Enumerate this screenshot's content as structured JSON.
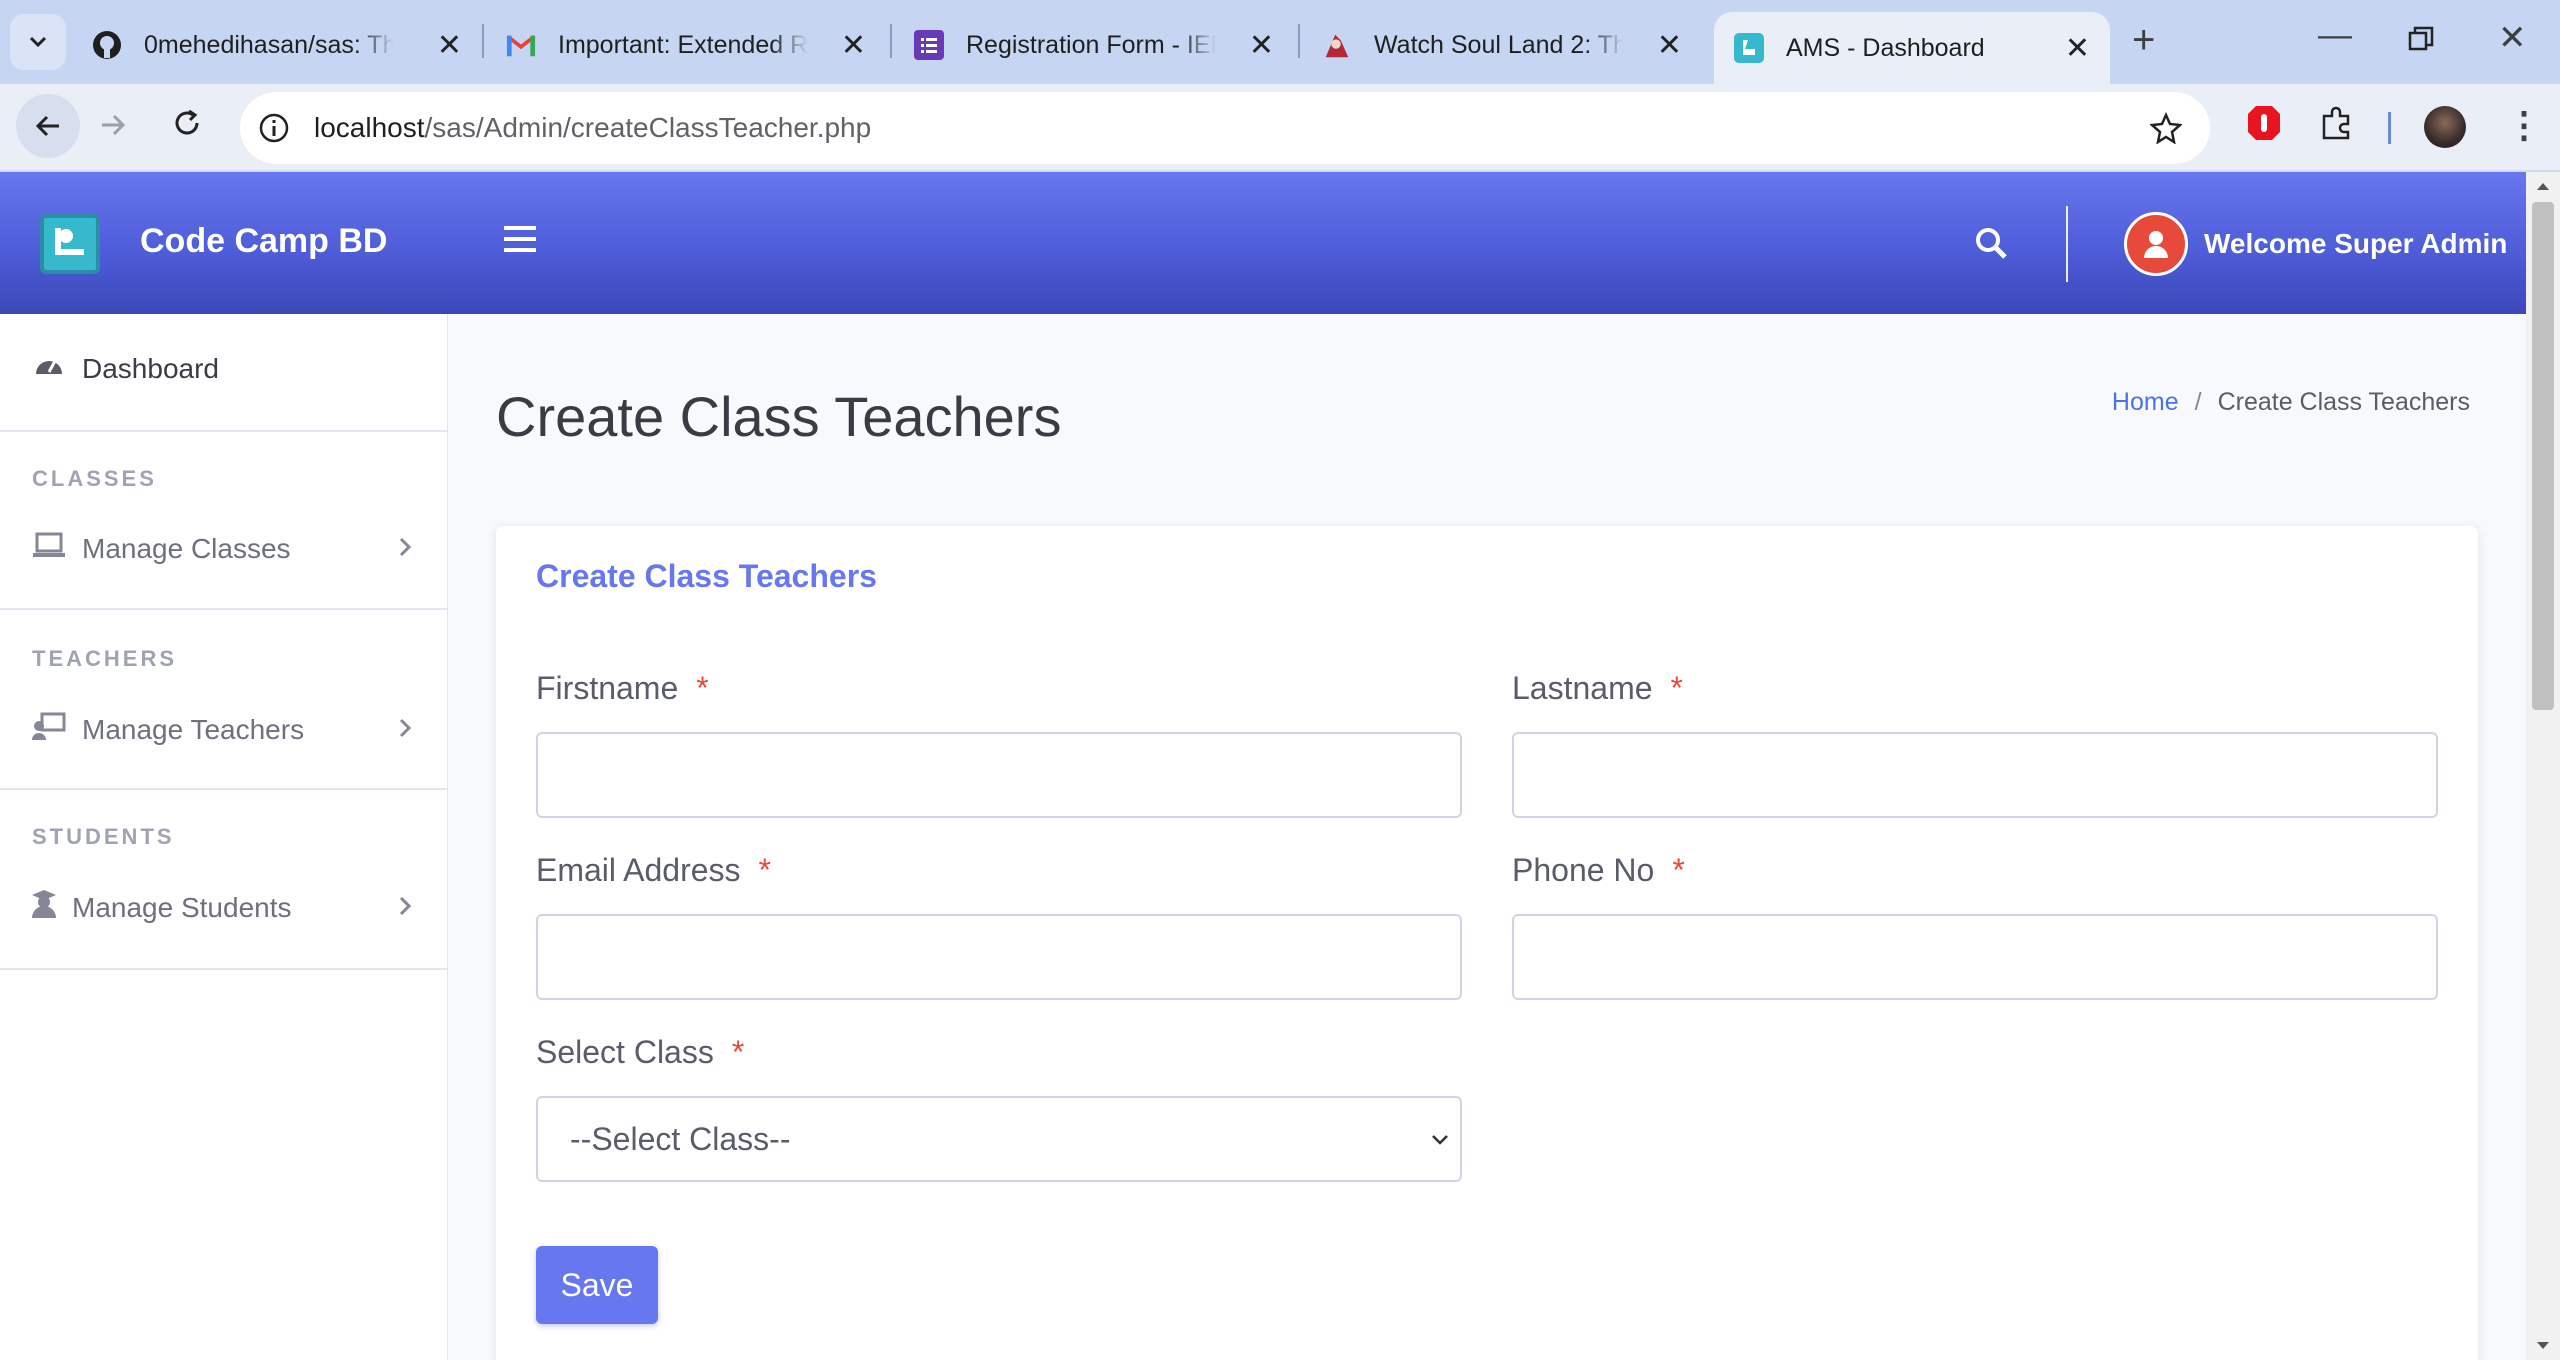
{
  "browser": {
    "tabs": [
      {
        "title": "0mehedihasan/sas: The S",
        "icon": "github-icon"
      },
      {
        "title": "Important: Extended Reg",
        "icon": "gmail-icon"
      },
      {
        "title": "Registration Form - IEEE",
        "icon": "forms-icon"
      },
      {
        "title": "Watch Soul Land 2: The P",
        "icon": "anime-icon"
      },
      {
        "title": "AMS - Dashboard",
        "icon": "ams-icon",
        "active": true
      }
    ],
    "url_host": "localhost",
    "url_path": "/sas/Admin/createClassTeacher.php"
  },
  "header": {
    "brand": "Code Camp BD",
    "user_greeting": "Welcome Super Admin"
  },
  "sidebar": {
    "dashboard": "Dashboard",
    "sections": [
      {
        "title": "CLASSES",
        "item": "Manage Classes"
      },
      {
        "title": "TEACHERS",
        "item": "Manage Teachers"
      },
      {
        "title": "STUDENTS",
        "item": "Manage Students"
      }
    ]
  },
  "page": {
    "title": "Create Class Teachers",
    "breadcrumb_home": "Home",
    "breadcrumb_sep": "/",
    "breadcrumb_current": "Create Class Teachers"
  },
  "form": {
    "card_title": "Create Class Teachers",
    "required_mark": "*",
    "firstname_label": "Firstname",
    "lastname_label": "Lastname",
    "email_label": "Email Address",
    "phone_label": "Phone No",
    "class_label": "Select Class",
    "class_selected": "--Select Class--",
    "save_label": "Save"
  },
  "colors": {
    "primary": "#6777ef",
    "required": "#e74a3b",
    "chrome_tabbar": "#c6d5f2"
  }
}
